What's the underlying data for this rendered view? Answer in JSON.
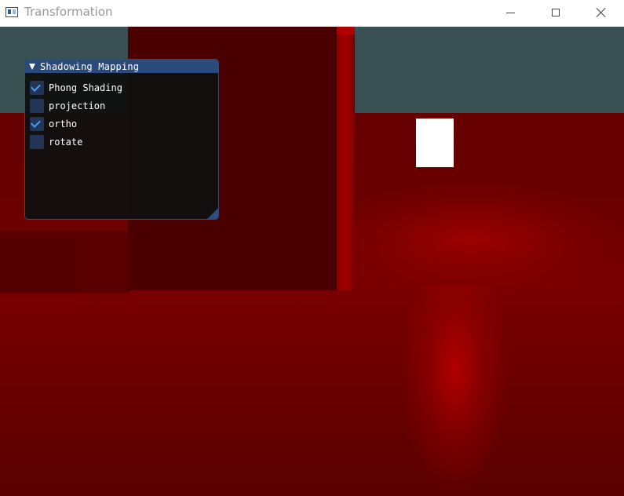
{
  "window": {
    "title": "Transformation",
    "app_icon": "app-window-icon",
    "controls": {
      "minimize_icon": "minimize-icon",
      "maximize_icon": "maximize-icon",
      "close_icon": "close-icon"
    }
  },
  "scene": {
    "colors": {
      "sky": "#395052",
      "floor": "#660000",
      "cube": "#4b0000",
      "light": "#ffffff"
    }
  },
  "panel": {
    "title": "Shadowing Mapping",
    "collapse_icon": "triangle-down-icon",
    "checkboxes": [
      {
        "label": "Phong Shading",
        "checked": true
      },
      {
        "label": "projection",
        "checked": false
      },
      {
        "label": "ortho",
        "checked": true
      },
      {
        "label": "rotate",
        "checked": false
      }
    ],
    "colors": {
      "header": "#294a7a",
      "check": "#4d9cf0",
      "box": "#223556"
    }
  }
}
